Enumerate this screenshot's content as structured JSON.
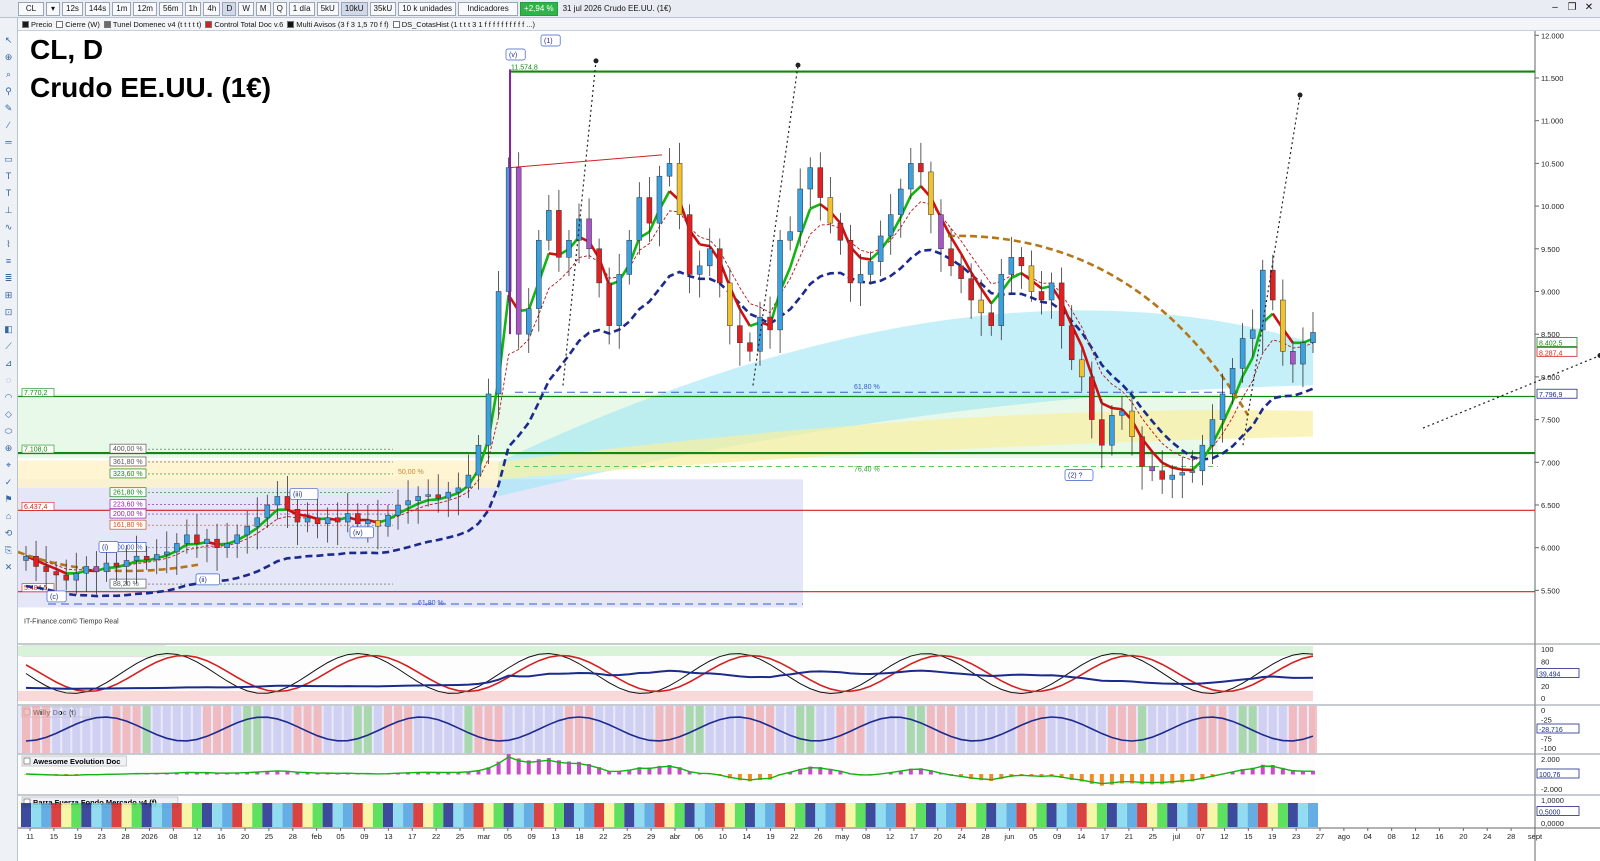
{
  "toolbar": {
    "symbol": "CL",
    "timeframes": [
      "12s",
      "144s",
      "1m",
      "12m",
      "56m",
      "1h",
      "4h",
      "D",
      "W",
      "M",
      "Q"
    ],
    "period": "1 día",
    "unit_buttons": [
      "5kU",
      "10kU",
      "35kU"
    ],
    "units": "10 k unidades",
    "indicators_label": "Indicadores",
    "change": "+2,94 %",
    "status": "31 jul 2026 Crudo EE.UU. (1€)"
  },
  "overlays": [
    {
      "label": "Precio",
      "color": "#1a1a1a"
    },
    {
      "label": "Cierre (W)",
      "color": "#ffffff"
    },
    {
      "label": "Tunel Domenec v4 (t t t t t)",
      "color": "#6b6b6b"
    },
    {
      "label": "Control Total Doc v.6",
      "color": "#d42020"
    },
    {
      "label": "Multi Avisos (3 f 3 1,5 70 f f)",
      "color": "#111111"
    },
    {
      "label": "DS_CotasHist (1 t t t 3 1 f f f f f f f f f f ...)",
      "color": "#ffffff"
    }
  ],
  "chart_title": "CL, D",
  "chart_subtitle": "Crudo EE.UU. (1€)",
  "colors": {
    "up": "#3aa0e0",
    "down": "#e02020",
    "ema_fast_up": "#12b312",
    "ema_fast_down": "#d01010",
    "ema_slow": "#1c2a8c",
    "arc": "#b5761a",
    "support": "#118811"
  },
  "chart_data": {
    "type": "candlestick",
    "ylim": [
      5.2,
      12.05
    ],
    "y_ticks": [
      "5.500",
      "6.000",
      "6.500",
      "7.000",
      "7.500",
      "8.000",
      "8.500",
      "9.000",
      "9.500",
      "10.000",
      "10.500",
      "11.000",
      "11.500",
      "12.000"
    ],
    "y_tick_values": [
      5.5,
      6.0,
      6.5,
      7.0,
      7.5,
      8.0,
      8.5,
      9.0,
      9.5,
      10.0,
      10.5,
      11.0,
      11.5,
      12.0
    ],
    "x_ticks": [
      "11",
      "15",
      "19",
      "23",
      "28",
      "2026",
      "08",
      "12",
      "16",
      "20",
      "25",
      "28",
      "feb",
      "05",
      "09",
      "13",
      "17",
      "22",
      "25",
      "mar",
      "05",
      "09",
      "13",
      "18",
      "22",
      "25",
      "29",
      "abr",
      "06",
      "10",
      "14",
      "19",
      "22",
      "26",
      "may",
      "08",
      "12",
      "17",
      "20",
      "24",
      "28",
      "jun",
      "05",
      "09",
      "14",
      "17",
      "21",
      "25",
      "jul",
      "07",
      "12",
      "15",
      "19",
      "23",
      "27",
      "ago",
      "04",
      "08",
      "12",
      "16",
      "20",
      "24",
      "28",
      "sept"
    ],
    "horizontal_levels": [
      {
        "value": 11.5748,
        "label": "11.574,8",
        "color": "#118811"
      },
      {
        "value": 7.7702,
        "label": "7.770,2",
        "color": "#118811"
      },
      {
        "value": 7.108,
        "label": "7.108,0",
        "color": "#118811"
      },
      {
        "value": 6.4374,
        "label": "6.437,4",
        "color": "#d42020"
      },
      {
        "value": 5.4845,
        "label": "5.484,5",
        "color": "#d42020"
      }
    ],
    "right_labels": [
      {
        "value": 8.4025,
        "label": "8.402,5",
        "color": "#118811"
      },
      {
        "value": 8.2874,
        "label": "8.287,4",
        "color": "#d42020"
      },
      {
        "value": 7.7969,
        "label": "7.796,9",
        "color": "#1c2a8c"
      }
    ],
    "fib_labels": [
      "400,00 %",
      "361,80 %",
      "323,60 %",
      "261,80 %",
      "223,60 %",
      "200,00 %",
      "161,80 %",
      "100,00 %",
      "88,20 %",
      "61,80 %",
      "50,00 %",
      "76,40 %"
    ],
    "wave_labels": [
      "(v)",
      "(1)",
      "(iii)",
      "(iv)",
      "(i)",
      "(ii)",
      "(c)",
      "(2) ?"
    ],
    "closes": [
      5.9,
      5.78,
      5.72,
      5.68,
      5.62,
      5.7,
      5.78,
      5.72,
      5.82,
      5.78,
      5.85,
      5.9,
      5.86,
      5.92,
      5.95,
      6.05,
      6.15,
      6.05,
      6.1,
      6.0,
      6.05,
      6.15,
      6.25,
      6.35,
      6.5,
      6.6,
      6.45,
      6.3,
      6.35,
      6.28,
      6.35,
      6.3,
      6.4,
      6.28,
      6.32,
      6.25,
      6.38,
      6.5,
      6.55,
      6.6,
      6.62,
      6.58,
      6.65,
      6.7,
      6.85,
      7.2,
      7.8,
      9.0,
      10.45,
      8.5,
      8.8,
      9.6,
      9.95,
      9.4,
      9.6,
      9.85,
      9.5,
      9.1,
      8.6,
      9.2,
      9.6,
      10.1,
      9.8,
      10.35,
      10.5,
      9.9,
      9.2,
      9.3,
      9.5,
      9.1,
      8.6,
      8.4,
      8.3,
      8.7,
      8.55,
      9.6,
      9.7,
      10.2,
      10.45,
      10.1,
      9.8,
      9.6,
      9.1,
      9.2,
      9.35,
      9.65,
      9.9,
      10.2,
      10.5,
      10.4,
      9.9,
      9.5,
      9.3,
      9.15,
      8.9,
      8.75,
      8.6,
      9.2,
      9.4,
      9.3,
      9.0,
      8.9,
      9.1,
      8.6,
      8.2,
      8.0,
      7.5,
      7.2,
      7.55,
      7.6,
      7.3,
      6.95,
      6.9,
      6.8,
      6.85,
      6.88,
      6.9,
      7.2,
      7.5,
      7.8,
      8.1,
      8.45,
      8.55,
      9.25,
      8.9,
      8.3,
      8.15,
      8.4,
      8.52
    ]
  },
  "panels": [
    {
      "title": "Sistema de trenes Doc v4 (f f)",
      "scale": [
        "100",
        "80",
        "50",
        "20",
        "0"
      ],
      "value_label": "39,494"
    },
    {
      "title": "Willy Doc (t)",
      "scale": [
        "0",
        "-25",
        "-50",
        "-75",
        "-100"
      ],
      "value_label": "-28,716"
    },
    {
      "title": "Awesome Evolution Doc",
      "scale": [
        "2.000",
        "0",
        "-2.000"
      ],
      "value_label": "100,76"
    },
    {
      "title": "Barra Fuerza Fondo Mercado v4 (f)",
      "scale": [
        "1,0000",
        "0,5000",
        "0,0000"
      ],
      "value_label": "0,5000"
    }
  ],
  "watermark": "IT-Finance.com© Tiempo Real"
}
